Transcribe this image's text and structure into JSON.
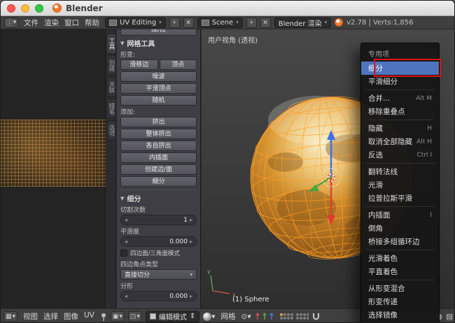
{
  "colors": {
    "accent": "#4d74bd",
    "annotation": "#e01212",
    "wireframe": "#ffa028"
  },
  "titlebar": {
    "title": "Blender"
  },
  "menubar": {
    "menus": [
      "文件",
      "渲染",
      "窗口",
      "帮助"
    ],
    "layout_value": "UV Editing",
    "scene_value": "Scene",
    "engine_value": "Blender 渲染",
    "stats": "v2.78 | Verts:1,856"
  },
  "toolshelf": {
    "tabs": [
      "工具",
      "创建",
      "关联",
      "蜡笔",
      "选项"
    ],
    "partial_top_button": "推/拉",
    "mesh_tools": {
      "title": "网格工具",
      "deform_label": "形变:",
      "deform_row": [
        "滑移边",
        "顶点"
      ],
      "deform_buttons": [
        "噪波",
        "平滑顶点",
        "随机"
      ],
      "add_label": "添加:",
      "add_buttons": [
        "挤出",
        "整体挤出",
        "各自挤出",
        "内插面",
        "创建边/面",
        "细分"
      ]
    },
    "subdivide_panel": {
      "title": "细分",
      "cuts_label": "切割次数",
      "cuts_value": "1",
      "smooth_label": "平滑度",
      "smooth_value": "0.000",
      "quadtri_label": "四边面/三角面模式",
      "corner_label": "四边角点类型",
      "corner_value": "直接切分",
      "fractal_label": "分形",
      "fractal_value": "0.000"
    }
  },
  "viewport": {
    "view_label": "用户视角 (透视)",
    "object_label": "(1) Sphere",
    "axis_x": "x",
    "axis_y": "y"
  },
  "context_menu": {
    "title": "专用项",
    "items": [
      {
        "label": "细分",
        "shortcut": "",
        "highlighted": true
      },
      {
        "label": "平滑细分",
        "shortcut": ""
      },
      {
        "sep": true
      },
      {
        "label": "合并...",
        "shortcut": "Alt M"
      },
      {
        "label": "移除重叠点",
        "shortcut": ""
      },
      {
        "sep": true
      },
      {
        "label": "隐藏",
        "shortcut": "H"
      },
      {
        "label": "取消全部隐藏",
        "shortcut": "Alt H"
      },
      {
        "label": "反选",
        "shortcut": "Ctrl I"
      },
      {
        "sep": true
      },
      {
        "label": "翻转法线",
        "shortcut": ""
      },
      {
        "label": "光滑",
        "shortcut": ""
      },
      {
        "label": "拉普拉斯平滑",
        "shortcut": ""
      },
      {
        "sep": true
      },
      {
        "label": "内插面",
        "shortcut": "I"
      },
      {
        "label": "倒角",
        "shortcut": ""
      },
      {
        "label": "桥接多组循环边",
        "shortcut": ""
      },
      {
        "sep": true
      },
      {
        "label": "光滑着色",
        "shortcut": ""
      },
      {
        "label": "平直着色",
        "shortcut": ""
      },
      {
        "sep": true
      },
      {
        "label": "从形变混合",
        "shortcut": ""
      },
      {
        "label": "形变传递",
        "shortcut": ""
      },
      {
        "label": "选择镜像",
        "shortcut": ""
      }
    ]
  },
  "bottombar": {
    "uv_menus": [
      "视图",
      "选择",
      "图像",
      "UV"
    ],
    "mode_value": "编辑模式",
    "mesh_menu": "网格"
  }
}
